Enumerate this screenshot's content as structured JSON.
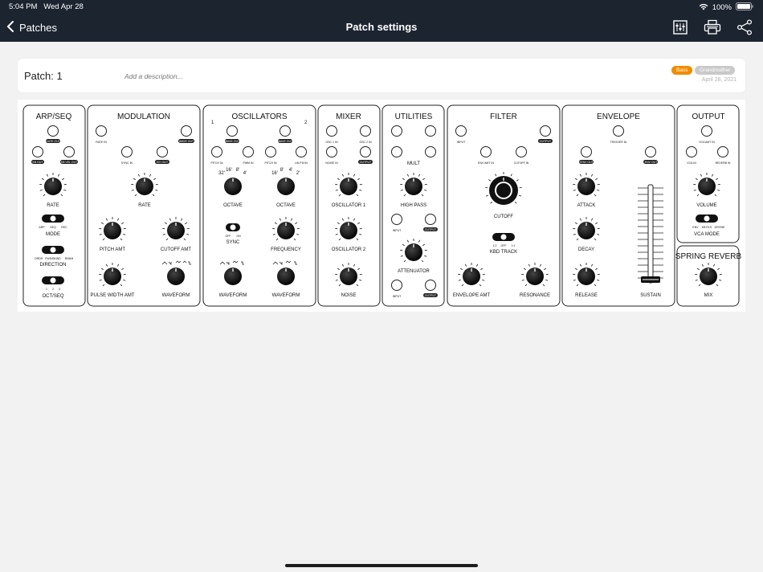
{
  "status": {
    "time": "5:04 PM",
    "date": "Wed Apr 28",
    "battery": "100%"
  },
  "nav": {
    "back_label": "Patches",
    "title": "Patch settings"
  },
  "patch": {
    "name": "Patch: 1",
    "description_placeholder": "Add a description...",
    "tags": [
      "Bass",
      "Grandmother"
    ],
    "date": "April 28, 2021"
  },
  "modules": {
    "arpseq": {
      "title": "ARP/SEQ",
      "jack_gate": "GATE OUT",
      "jack_kb": "KB OUT",
      "jack_kbvel": "KB VEL OUT",
      "rate": "RATE",
      "mode": "MODE",
      "mode_opts": [
        "ARP",
        "SEQ",
        "REC"
      ],
      "direction": "DIRECTION",
      "dir_opts": [
        "ORDR",
        "FWD/BKWD",
        "RNDM"
      ],
      "octseq": "OCT/SEQ",
      "oct_opts": [
        "1",
        "2",
        "3"
      ]
    },
    "modulation": {
      "title": "MODULATION",
      "jack_rate": "RATE IN",
      "jack_wave": "WAVE OUT",
      "jack_sync": "SYNC IN",
      "jack_sh": "S/H OUT",
      "rate": "RATE",
      "pitch_amt": "PITCH AMT",
      "cutoff_amt": "CUTOFF AMT",
      "pw_amt": "PULSE WIDTH AMT",
      "waveform": "WAVEFORM"
    },
    "oscillators": {
      "title": "OSCILLATORS",
      "osc1": "1",
      "osc2": "2",
      "jack_wave": "WAVE OUT",
      "jack_pitch": "PITCH IN",
      "jack_pwm": "PWM IN",
      "jack_linfm": "LIN FM IN",
      "octave": "OCTAVE",
      "oct_marks": [
        "32'",
        "16'",
        "8'",
        "4'"
      ],
      "oct_marks2": [
        "16'",
        "8'",
        "4'",
        "2'"
      ],
      "sync": "SYNC",
      "sync_opts": [
        "OFF",
        "ON"
      ],
      "frequency": "FREQUENCY",
      "waveform": "WAVEFORM"
    },
    "mixer": {
      "title": "MIXER",
      "jack_osc1": "OSC 1 IN",
      "jack_osc2": "OSC 2 IN",
      "jack_noise": "NOISE IN",
      "jack_out": "OUTPUT",
      "osc1": "OSCILLATOR 1",
      "osc2": "OSCILLATOR 2",
      "noise": "NOISE"
    },
    "utilities": {
      "title": "UTILITIES",
      "mult": "MULT",
      "high_pass": "HIGH PASS",
      "jack_in": "INPUT",
      "jack_out": "OUTPUT",
      "attenuator": "ATTENUATOR"
    },
    "filter": {
      "title": "FILTER",
      "jack_in": "INPUT",
      "jack_out": "OUTPUT",
      "jack_env": "ENV AMT IN",
      "jack_cutoff": "CUTOFF IN",
      "cutoff": "CUTOFF",
      "kbd_track": "KBD TRACK",
      "kbd_opts": [
        "1:2",
        "OFF",
        "1:1"
      ],
      "env_amt": "ENVELOPE AMT",
      "resonance": "RESONANCE"
    },
    "envelope": {
      "title": "ENVELOPE",
      "jack_trig": "TRIGGER IN",
      "jack_env": "+ENV OUT",
      "jack_negenv": "-ENV OUT",
      "attack": "ATTACK",
      "decay": "DECAY",
      "release": "RELEASE",
      "sustain": "SUSTAIN"
    },
    "output": {
      "title": "OUTPUT",
      "jack_vca": "VCA AMT IN",
      "jack_vcain": "VCA IN",
      "jack_reverb": "REVERB IN",
      "volume": "VOLUME",
      "vca_mode": "VCA MODE",
      "vca_opts": [
        "ENV",
        "KB RLS",
        "DRONE"
      ]
    },
    "reverb": {
      "title": "SPRING REVERB",
      "mix": "MIX"
    }
  }
}
